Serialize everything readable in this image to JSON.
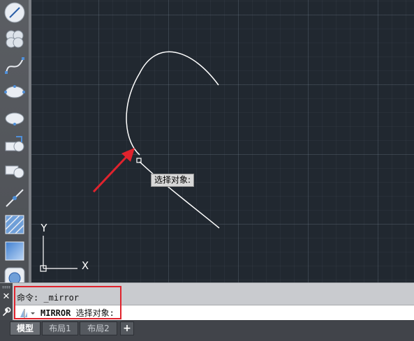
{
  "toolbar": {
    "tools": [
      {
        "name": "line-tool-icon"
      },
      {
        "name": "revcloud-tool-icon"
      },
      {
        "name": "spline-tool-icon"
      },
      {
        "name": "ellipse-tool-icon"
      },
      {
        "name": "ellipse-arc-tool-icon"
      },
      {
        "name": "insert-block-tool-icon"
      },
      {
        "name": "make-block-tool-icon"
      },
      {
        "name": "point-tool-icon"
      },
      {
        "name": "hatch-tool-icon"
      },
      {
        "name": "gradient-tool-icon"
      },
      {
        "name": "region-tool-icon"
      }
    ]
  },
  "canvas": {
    "background": "#212830",
    "curve_color": "#ffffff",
    "arrow_color": "#e0232d",
    "ucs": {
      "x_label": "X",
      "y_label": "Y"
    },
    "tooltip": "选择对象:"
  },
  "command": {
    "history_line": "命令: _mirror",
    "input_keyword": "MIRROR",
    "input_prompt": "选择对象:",
    "highlight_color": "#e0232d"
  },
  "tabs": [
    {
      "label": "模型",
      "active": true
    },
    {
      "label": "布局1",
      "active": false
    },
    {
      "label": "布局2",
      "active": false
    }
  ],
  "tab_add_label": "+"
}
